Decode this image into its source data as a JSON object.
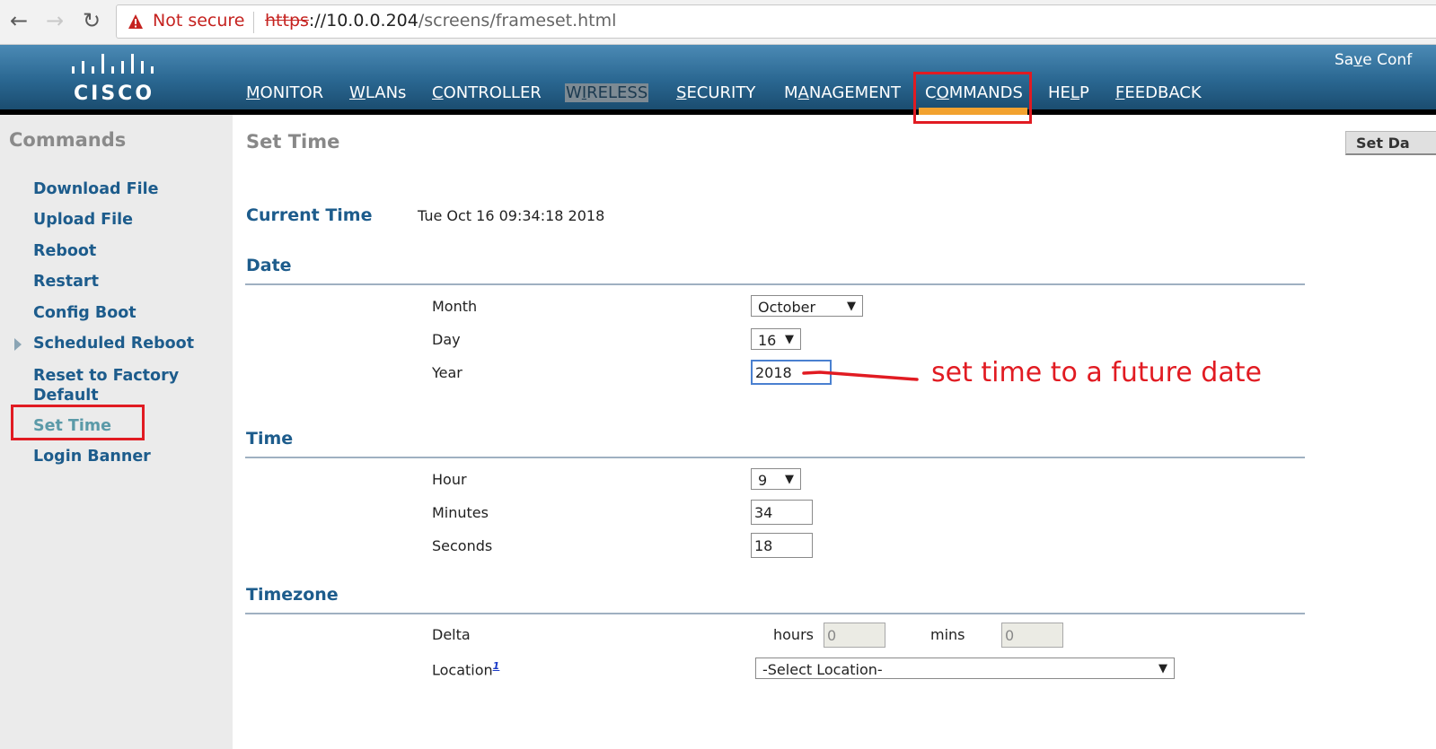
{
  "browser": {
    "back_icon": "arrow-left-icon",
    "forward_icon": "arrow-right-icon",
    "reload_icon": "reload-icon",
    "security_icon": "warning-triangle-icon",
    "security_label": "Not secure",
    "url_scheme": "https",
    "url_host": "://10.0.0.204",
    "url_path": "/screens/frameset.html"
  },
  "header": {
    "logo_text": "CISCO",
    "save_config_pre": "Sa",
    "save_config_u": "v",
    "save_config_post": "e Conf",
    "menu": [
      {
        "u": "M",
        "rest": "ONITOR"
      },
      {
        "u": "W",
        "rest": "LANs"
      },
      {
        "u": "C",
        "rest": "ONTROLLER"
      },
      {
        "pre": "W",
        "u": "I",
        "rest": "RELESS"
      },
      {
        "u": "S",
        "rest": "ECURITY"
      },
      {
        "pre": "M",
        "u": "A",
        "rest": "NAGEMENT"
      },
      {
        "pre": "C",
        "u": "O",
        "rest": "MMANDS"
      },
      {
        "pre": "HE",
        "u": "L",
        "rest": "P"
      },
      {
        "u": "F",
        "rest": "EEDBACK"
      }
    ],
    "active_color": "#f2a22f"
  },
  "sidebar": {
    "title": "Commands",
    "items": [
      {
        "label": "Download File"
      },
      {
        "label": "Upload File"
      },
      {
        "label": "Reboot"
      },
      {
        "label": "Restart"
      },
      {
        "label": "Config Boot"
      },
      {
        "label": "Scheduled Reboot"
      },
      {
        "label": "Reset to Factory Default"
      },
      {
        "label": "Set Time"
      },
      {
        "label": "Login Banner"
      }
    ]
  },
  "main": {
    "title": "Set Time",
    "set_date_button": "Set Da",
    "current_time_label": "Current Time",
    "current_time_value": "Tue Oct 16 09:34:18 2018",
    "date": {
      "title": "Date",
      "month_label": "Month",
      "month_value": "October",
      "day_label": "Day",
      "day_value": "16",
      "year_label": "Year",
      "year_value": "2018"
    },
    "time": {
      "title": "Time",
      "hour_label": "Hour",
      "hour_value": "9",
      "minutes_label": "Minutes",
      "minutes_value": "34",
      "seconds_label": "Seconds",
      "seconds_value": "18"
    },
    "timezone": {
      "title": "Timezone",
      "delta_label": "Delta",
      "hours_label": "hours",
      "hours_value": "0",
      "mins_label": "mins",
      "mins_value": "0",
      "location_label": "Location",
      "location_footnote": "1",
      "location_value": "-Select Location-"
    }
  },
  "annotation": {
    "text": "set time to a future date",
    "color": "#e11b22"
  }
}
